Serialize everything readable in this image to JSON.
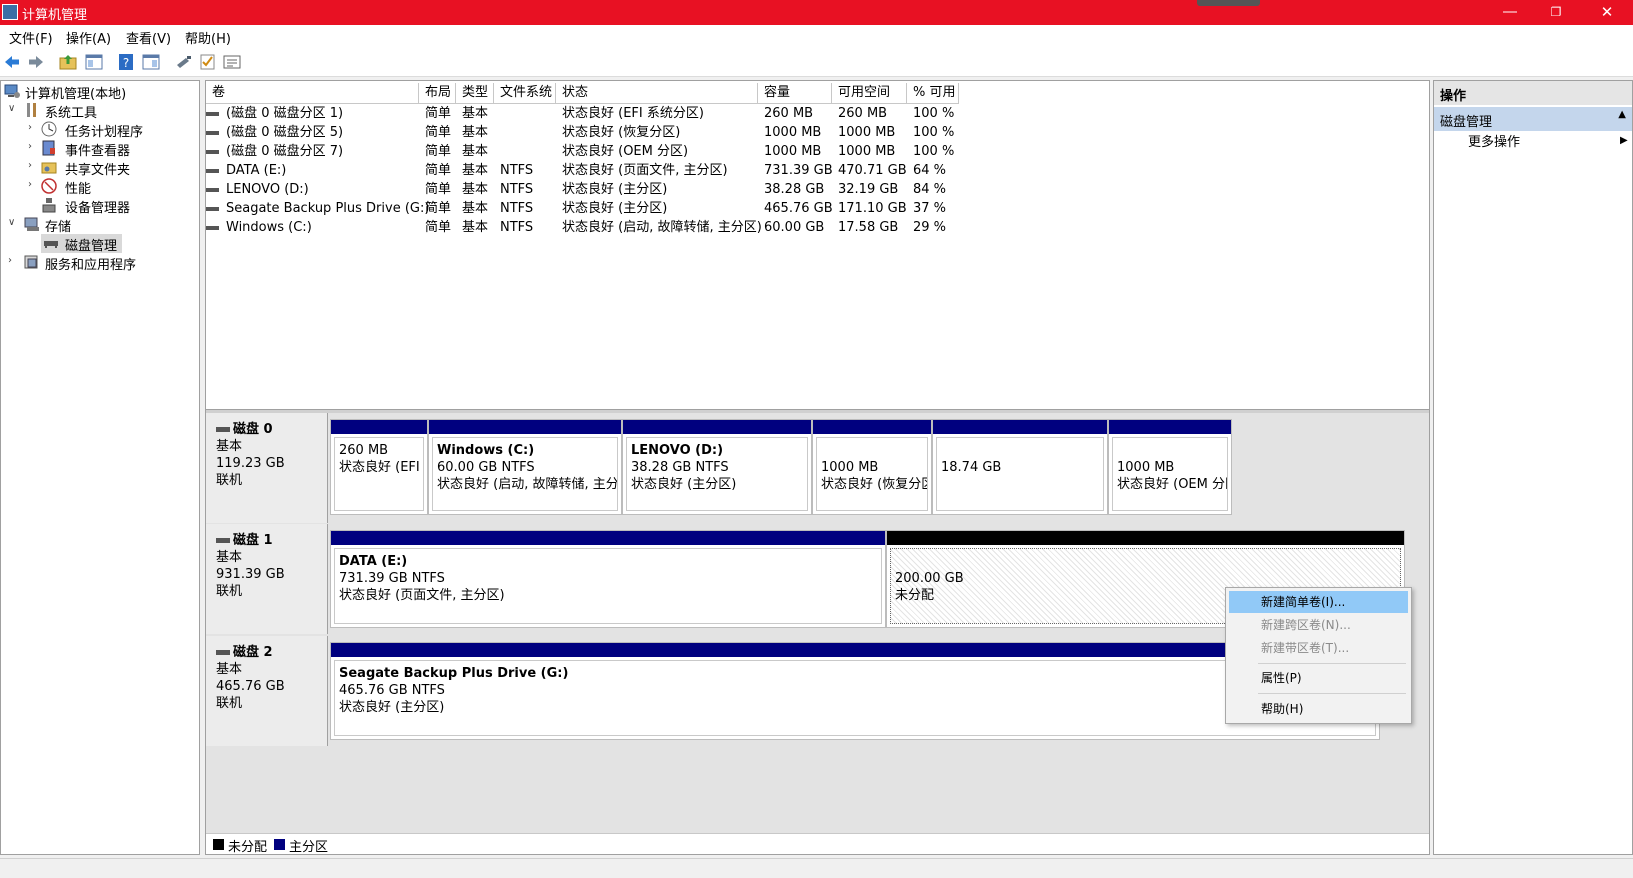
{
  "window": {
    "title": "计算机管理",
    "min_icon": "minimize-icon",
    "max_icon": "restore-icon",
    "close_icon": "close-icon"
  },
  "menu": [
    "文件(F)",
    "操作(A)",
    "查看(V)",
    "帮助(H)"
  ],
  "toolbar_icons": [
    "back-icon",
    "forward-icon",
    "up-folder-icon",
    "show-hide-tree-icon",
    "help-icon",
    "properties-icon",
    "connect-icon",
    "check-icon",
    "list-icon"
  ],
  "tree": {
    "root": "计算机管理(本地)",
    "system_tools": "系统工具",
    "task_scheduler": "任务计划程序",
    "event_viewer": "事件查看器",
    "shared_folders": "共享文件夹",
    "performance": "性能",
    "device_manager": "设备管理器",
    "storage": "存储",
    "disk_management": "磁盘管理",
    "services_apps": "服务和应用程序"
  },
  "volume_table": {
    "headers": [
      "卷",
      "布局",
      "类型",
      "文件系统",
      "状态",
      "容量",
      "可用空间",
      "% 可用"
    ],
    "rows": [
      [
        "(磁盘 0 磁盘分区 1)",
        "简单",
        "基本",
        "",
        "状态良好 (EFI 系统分区)",
        "260 MB",
        "260 MB",
        "100 %"
      ],
      [
        "(磁盘 0 磁盘分区 5)",
        "简单",
        "基本",
        "",
        "状态良好 (恢复分区)",
        "1000 MB",
        "1000 MB",
        "100 %"
      ],
      [
        "(磁盘 0 磁盘分区 7)",
        "简单",
        "基本",
        "",
        "状态良好 (OEM 分区)",
        "1000 MB",
        "1000 MB",
        "100 %"
      ],
      [
        "DATA (E:)",
        "简单",
        "基本",
        "NTFS",
        "状态良好 (页面文件, 主分区)",
        "731.39 GB",
        "470.71 GB",
        "64 %"
      ],
      [
        "LENOVO (D:)",
        "简单",
        "基本",
        "NTFS",
        "状态良好 (主分区)",
        "38.28 GB",
        "32.19 GB",
        "84 %"
      ],
      [
        "Seagate Backup Plus Drive (G:)",
        "简单",
        "基本",
        "NTFS",
        "状态良好 (主分区)",
        "465.76 GB",
        "171.10 GB",
        "37 %"
      ],
      [
        "Windows (C:)",
        "简单",
        "基本",
        "NTFS",
        "状态良好 (启动, 故障转储, 主分区)",
        "60.00 GB",
        "17.58 GB",
        "29 %"
      ]
    ]
  },
  "disks": {
    "d0": {
      "name": "磁盘 0",
      "type": "基本",
      "size": "119.23 GB",
      "status": "联机",
      "p1": {
        "line1": "260 MB",
        "line2": "状态良好 (EFI 系"
      },
      "p2": {
        "title": "Windows  (C:)",
        "line1": "60.00 GB NTFS",
        "line2": "状态良好 (启动, 故障转储, 主分区"
      },
      "p3": {
        "title": "LENOVO  (D:)",
        "line1": "38.28 GB NTFS",
        "line2": "状态良好 (主分区)"
      },
      "p4": {
        "line1": "1000 MB",
        "line2": "状态良好 (恢复分区"
      },
      "p5": {
        "line1": "18.74 GB"
      },
      "p6": {
        "line1": "1000 MB",
        "line2": "状态良好 (OEM 分区"
      }
    },
    "d1": {
      "name": "磁盘 1",
      "type": "基本",
      "size": "931.39 GB",
      "status": "联机",
      "p1": {
        "title": "DATA  (E:)",
        "line1": "731.39 GB NTFS",
        "line2": "状态良好 (页面文件, 主分区)"
      },
      "p2": {
        "line1": "200.00 GB",
        "line2": "未分配"
      }
    },
    "d2": {
      "name": "磁盘 2",
      "type": "基本",
      "size": "465.76 GB",
      "status": "联机",
      "p1": {
        "title": "Seagate Backup Plus Drive  (G:)",
        "line1": "465.76 GB NTFS",
        "line2": "状态良好 (主分区)"
      }
    }
  },
  "legend": {
    "unallocated": "未分配",
    "primary": "主分区"
  },
  "actions": {
    "title": "操作",
    "section": "磁盘管理",
    "more": "更多操作"
  },
  "context_menu": {
    "new_simple": "新建简单卷(I)...",
    "new_spanned": "新建跨区卷(N)...",
    "new_striped": "新建带区卷(T)...",
    "properties": "属性(P)",
    "help": "帮助(H)"
  },
  "colors": {
    "titlebar": "#e81123",
    "primary_partition": "#00007f",
    "unallocated": "#000000",
    "menu_highlight": "#91c9f7"
  }
}
